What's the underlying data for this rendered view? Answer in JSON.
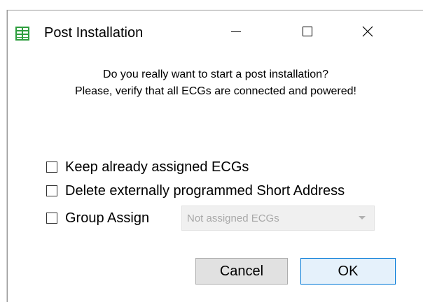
{
  "window": {
    "title": "Post Installation",
    "icon": "app-grid-icon",
    "controls": {
      "minimize_icon": "minimize-icon",
      "maximize_icon": "maximize-icon",
      "close_icon": "close-icon"
    }
  },
  "message": {
    "line1": "Do you really want to start a post installation?",
    "line2": "Please, verify that all ECGs are connected and powered!"
  },
  "options": [
    {
      "label": "Keep already assigned ECGs",
      "checked": false
    },
    {
      "label": "Delete externally programmed Short Address",
      "checked": false
    },
    {
      "label": "Group Assign",
      "checked": false
    }
  ],
  "group_select": {
    "value": "Not assigned ECGs",
    "enabled": false
  },
  "buttons": {
    "cancel_label": "Cancel",
    "ok_label": "OK"
  },
  "colors": {
    "icon_green": "#2e9e3e",
    "ok_border": "#0078d7",
    "button_face": "#e1e1e1",
    "disabled_text": "#a8a8a8"
  }
}
